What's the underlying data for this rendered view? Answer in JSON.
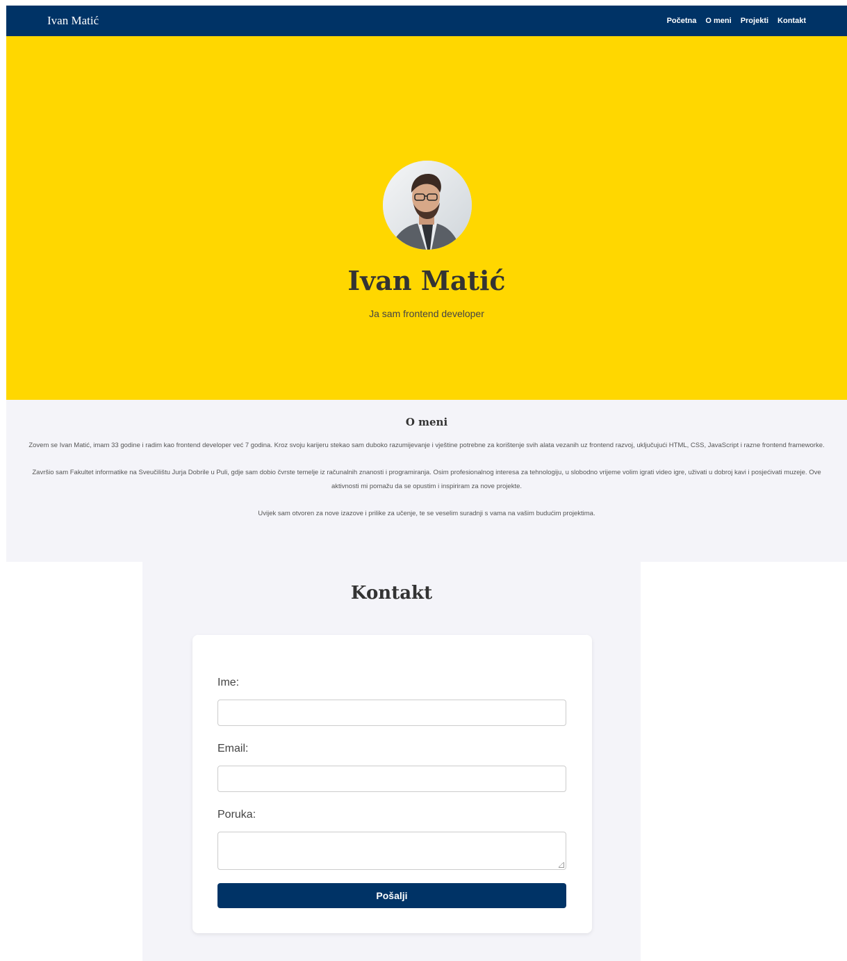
{
  "nav": {
    "brand": "Ivan Matić",
    "links": [
      "Početna",
      "O meni",
      "Projekti",
      "Kontakt"
    ]
  },
  "hero": {
    "name": "Ivan Matić",
    "subtitle": "Ja sam frontend developer"
  },
  "about": {
    "title": "O meni",
    "paragraphs": [
      "Zovem se Ivan Matić, imam 33 godine i radim kao frontend developer već 7 godina. Kroz svoju karijeru stekao sam duboko razumijevanje i vještine potrebne za korištenje svih alata vezanih uz frontend razvoj, uključujući HTML, CSS, JavaScript i razne frontend frameworke.",
      "Završio sam Fakultet informatike na Sveučilištu Jurja Dobrile u Puli, gdje sam dobio čvrste temelje iz računalnih znanosti i programiranja. Osim profesionalnog interesa za tehnologiju, u slobodno vrijeme volim igrati video igre, uživati u dobroj kavi i posjećivati muzeje. Ove aktivnosti mi pomažu da se opustim i inspiriram za nove projekte.",
      "Uvijek sam otvoren za nove izazove i prilike za učenje, te se veselim suradnji s vama na vašim budućim projektima."
    ]
  },
  "contact": {
    "title": "Kontakt",
    "name_label": "Ime:",
    "email_label": "Email:",
    "message_label": "Poruka:",
    "name_value": "",
    "email_value": "",
    "message_value": "",
    "submit_label": "Pošalji"
  },
  "colors": {
    "navy": "#003366",
    "yellow": "#ffd700",
    "light_bg": "#f4f4f9"
  }
}
